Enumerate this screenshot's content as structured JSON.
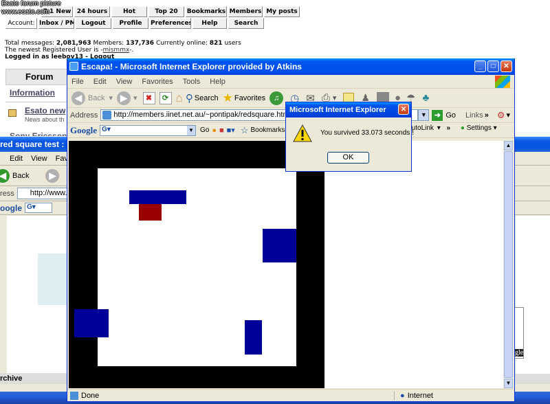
{
  "watermark": {
    "line1": "Esato forum picture",
    "line2": "www.esato.com"
  },
  "forum": {
    "nav_row1": [
      "7 1 New",
      "24 hours",
      "Hot",
      "Top 20",
      "Bookmarks",
      "Members",
      "My posts"
    ],
    "account_label": "Account:",
    "nav_row2": [
      "Inbox / PM",
      "Logout",
      "Profile",
      "Preferences",
      "Help",
      "Search"
    ],
    "stats_line1_prefix": "Total messages: ",
    "total_messages": "2,081,963",
    "members_label": " Members: ",
    "members": "137,736",
    "online_label": " Currently online: ",
    "online": "821",
    "users_label": " users",
    "newest_prefix": "The newest Registered User is -",
    "newest_user": "mismmx",
    "newest_suffix": "-.",
    "logged_in": "Logged in as leeboy13",
    "logout_link": "Logout",
    "forum_header": "Forum",
    "information_link": "Information",
    "esato_news": "Esato new",
    "news_about": "News about th",
    "sony_ericsson": "Sony Ericsson",
    "archive": "rchive"
  },
  "back_window": {
    "title": "red square test : N",
    "menu": [
      "Edit",
      "View",
      "Favo"
    ],
    "back_label": "Back",
    "address_label": "ress",
    "address": "http://www.es",
    "google_label": "oogle"
  },
  "main_window": {
    "title": "Escapa! - Microsoft Internet Explorer provided by Atkins",
    "menu": [
      "File",
      "Edit",
      "View",
      "Favorites",
      "Tools",
      "Help"
    ],
    "toolbar": {
      "back": "Back",
      "search": "Search",
      "favorites": "Favorites"
    },
    "address_label": "Address",
    "address": "http://members.iinet.net.au/~pontipak/redsquare.html",
    "go_label": "Go",
    "links_label": "Links",
    "google_label": "Google",
    "google_go": "Go",
    "bookmarks_label": "Bookmarks",
    "autolink_label": "AutoLink",
    "settings_label": "Settings",
    "status_done": "Done",
    "status_zone": "Internet"
  },
  "dialog": {
    "title": "Microsoft Internet Explorer",
    "message": "You survived 33.073 seconds !",
    "ok": "OK"
  },
  "colors": {
    "arena_border": "#000000",
    "red_square": "#990000",
    "blue_block": "#000099"
  }
}
